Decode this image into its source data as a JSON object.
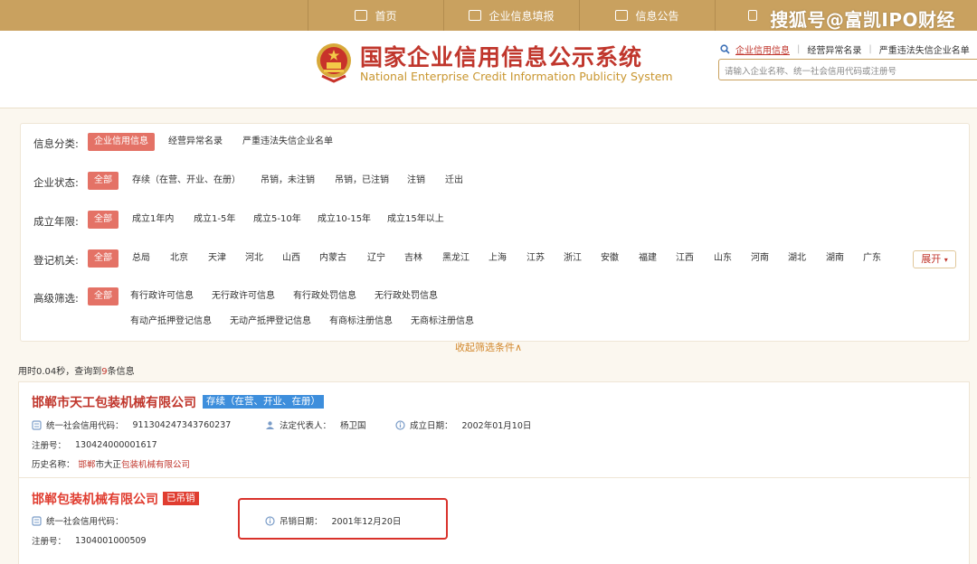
{
  "nav": {
    "items": [
      {
        "label": "首页",
        "icon": "monitor-icon"
      },
      {
        "label": "企业信息填报",
        "icon": "edit-icon"
      },
      {
        "label": "信息公告",
        "icon": "document-icon"
      },
      {
        "label": "",
        "icon": "speaker-icon"
      }
    ],
    "watermark": "搜狐号@富凯IPO财经"
  },
  "header": {
    "title_cn": "国家企业信用信息公示系统",
    "title_en": "National Enterprise Credit Information Publicity System",
    "links": [
      "企业信用信息",
      "经营异常名录",
      "严重违法失信企业名单"
    ],
    "search_placeholder": "请输入企业名称、统一社会信用代码或注册号"
  },
  "filters": {
    "category": {
      "label": "信息分类:",
      "options": [
        "企业信用信息",
        "经营异常名录",
        "严重违法失信企业名单"
      ]
    },
    "status": {
      "label": "企业状态:",
      "options": [
        "全部",
        "存续（在营、开业、在册）",
        "吊销，未注销",
        "吊销，已注销",
        "注销",
        "迁出"
      ]
    },
    "years": {
      "label": "成立年限:",
      "options": [
        "全部",
        "成立1年内",
        "成立1-5年",
        "成立5-10年",
        "成立10-15年",
        "成立15年以上"
      ]
    },
    "authority": {
      "label": "登记机关:",
      "options": [
        "全部",
        "总局",
        "北京",
        "天津",
        "河北",
        "山西",
        "内蒙古",
        "辽宁",
        "吉林",
        "黑龙江",
        "上海",
        "江苏",
        "浙江",
        "安徽",
        "福建",
        "江西",
        "山东",
        "河南",
        "湖北",
        "湖南",
        "广东"
      ],
      "expand": "展开"
    },
    "advanced": {
      "label": "高级筛选:",
      "options": [
        "全部",
        "有行政许可信息",
        "无行政许可信息",
        "有行政处罚信息",
        "无行政处罚信息",
        "有动产抵押登记信息",
        "无动产抵押登记信息",
        "有商标注册信息",
        "无商标注册信息"
      ]
    },
    "collapse": "收起筛选条件∧"
  },
  "stats": {
    "prefix": "用时0.04秒，查询到",
    "count": "9",
    "suffix": "条信息"
  },
  "results": [
    {
      "name": "邯郸市天工包装机械有限公司",
      "status": "存续（在营、开业、在册）",
      "credit_code_label": "统一社会信用代码：",
      "credit_code": "911304247343760237",
      "legal_rep_label": "法定代表人：",
      "legal_rep": "杨卫国",
      "date_label": "成立日期：",
      "date": "2002年01月10日",
      "reg_no_label": "注册号：",
      "reg_no": "130424000001617",
      "history_label": "历史名称：",
      "history_part1": "邯郸",
      "history_part2": "市大正",
      "history_part3": "包装机械有限公司"
    },
    {
      "name": "邯郸包装机械有限公司",
      "status": "已吊销",
      "credit_code_label": "统一社会信用代码：",
      "revoke_label": "吊销日期：",
      "revoke_date": "2001年12月20日",
      "reg_no_label": "注册号：",
      "reg_no": "1304001000509"
    }
  ],
  "colors": {
    "gold": "#c9a15f",
    "brand_red": "#c0362c",
    "chip_red": "#e47266",
    "status_blue": "#3d8edc",
    "revoked_red": "#e03d30"
  }
}
